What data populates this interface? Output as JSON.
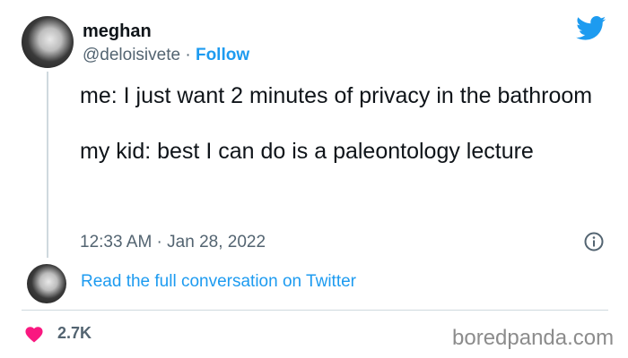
{
  "tweet": {
    "author": {
      "display_name": "meghan",
      "handle": "@deloisivete",
      "separator": " · ",
      "follow_label": "Follow"
    },
    "text": "me: I just want 2 minutes of privacy in the bathroom\n\nmy kid: best I can do is a paleontology lecture",
    "timestamp": "12:33 AM · Jan 28, 2022",
    "read_full_label": "Read the full conversation on Twitter",
    "likes": "2.7K"
  },
  "icons": {
    "brand": "twitter-bird-icon",
    "info": "info-icon",
    "like": "heart-icon"
  },
  "colors": {
    "accent": "#1d9bf0",
    "like": "#f91880",
    "secondary_text": "#536471"
  },
  "watermark": "boredpanda.com"
}
